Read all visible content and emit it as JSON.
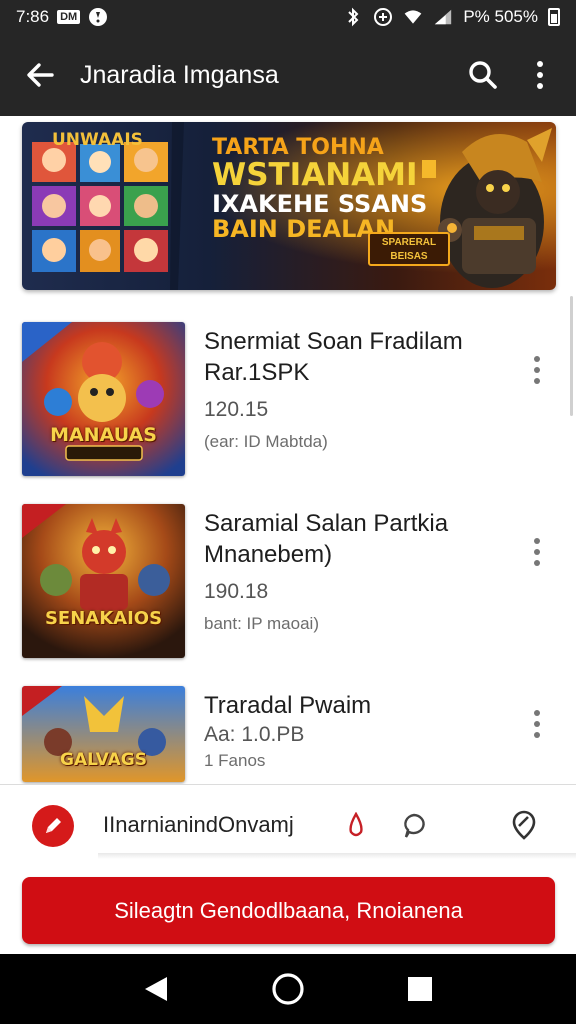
{
  "status_bar": {
    "time": "7:86",
    "left_badge": "DM",
    "battery_text": "P% 505%"
  },
  "app_bar": {
    "title": "Jnaradia Imgansa",
    "back_icon": "arrow-back-icon",
    "search_icon": "search-icon",
    "menu_icon": "more-vert-icon"
  },
  "banner": {
    "corner_text": "UNWAAIS",
    "line1": "TARTA TOHNA",
    "line2": "WSTIANAMI",
    "line3": "IXAKEHE SSANS",
    "line4": "BAIN DEALAN",
    "badge": "SPARERAL BEISAS"
  },
  "games": [
    {
      "title_line1": "Snermiat Soan Fradilam",
      "title_line2": "Rar.1SPK",
      "version": "120.15",
      "meta": "(ear: ID Mabtda)",
      "thumb_label": "MANAUAS",
      "colors": {
        "bg1": "#1f5fb8",
        "bg2": "#f08a1e"
      }
    },
    {
      "title_line1": "Saramial Salan Partkia",
      "title_line2": "Mnanebem)",
      "version": "190.18",
      "meta": "bant: IP maoai)",
      "thumb_label": "SENAKAIOS",
      "colors": {
        "bg1": "#3a1d12",
        "bg2": "#e8a021"
      }
    },
    {
      "title_line1": "Traradal Pwaim",
      "title_line2": "",
      "version": "Aa: 1.0.PB",
      "meta": "1 Fanos",
      "thumb_label": "GALVAGS",
      "colors": {
        "bg1": "#2c6bd0",
        "bg2": "#f2c23a"
      }
    }
  ],
  "bottom_panel": {
    "compose_label": "IInarnianindOnvamj",
    "compose_icon": "pencil-icon",
    "icon_a": "droplet-icon",
    "icon_b": "chat-bubble-icon",
    "icon_c": "location-pin-icon",
    "cta_label": "Sileagtn Gendodlbaana, Rnoianena"
  },
  "nav_bar": {
    "back": "nav-back-icon",
    "home": "nav-home-icon",
    "recents": "nav-recents-icon"
  },
  "colors": {
    "app_bar": "#262626",
    "accent": "#d00d13",
    "text": "#1e1e1e"
  }
}
